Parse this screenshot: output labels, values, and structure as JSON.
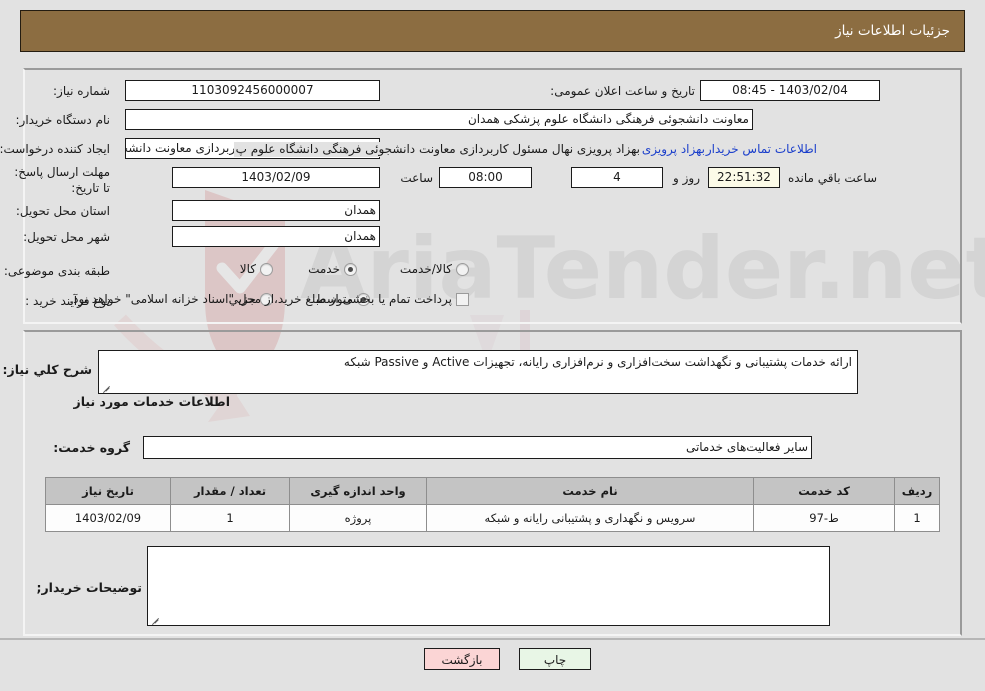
{
  "header": {
    "title": "جزئیات اطلاعات نیاز"
  },
  "top_form": {
    "need_number_label": "شماره نیاز:",
    "need_number_value": "1103092456000007",
    "announce_datetime_label": "تاریخ و ساعت اعلان عمومی:",
    "announce_datetime_value": "1403/02/04 - 08:45",
    "buyer_org_label": "نام دستگاه خریدار:",
    "buyer_org_value": "معاونت دانشجوئی فرهنگی دانشگاه علوم پزشکی همدان",
    "creator_label": "ایجاد کننده درخواست:",
    "creator_value": "بهزاد پرویزی نهال مسئول کاربردازی معاونت دانشجوئی فرهنگی دانشگاه علوم پز",
    "buyer_contact_link": "اطلاعات تماس خریدار",
    "deadline_label": "مهلت ارسال پاسخ: تا تاریخ:",
    "deadline_date": "1403/02/09",
    "deadline_time_label": "ساعت",
    "deadline_time": "08:00",
    "days_remaining": "4",
    "days_label": "روز و",
    "timer_value": "22:51:32",
    "timer_label": "ساعت باقي مانده",
    "province_label": "استان محل تحویل:",
    "province_value": "همدان",
    "city_label": "شهر محل تحویل:",
    "city_value": "همدان",
    "category_label": "طبقه بندی موضوعی:",
    "category_options": [
      {
        "label": "کالا",
        "selected": false
      },
      {
        "label": "خدمت",
        "selected": true
      },
      {
        "label": "کالا/خدمت",
        "selected": false
      }
    ],
    "process_label": "نوع فرآیند خرید :",
    "process_options": [
      {
        "label": "جزیي",
        "selected": false
      },
      {
        "label": "متوسط",
        "selected": true
      }
    ],
    "treasury_checkbox_label": "پرداخت تمام یا بخشی از مبلغ خرید،از محل \"اسناد خزانه اسلامی\" خواهد بود.",
    "treasury_checked": false
  },
  "description": {
    "label": "شرح کلي نیاز:",
    "value": "ارائه خدمات پشتیبانی و نگهداشت سخت‌افزاری و نرم‌افزاری رایانه، تجهیزات Active و Passive شبکه"
  },
  "services_section": {
    "heading": "اطلاعات خدمات مورد نیاز",
    "service_group_label": "گروه خدمت:",
    "service_group_value": "سایر فعالیت‌های خدماتی"
  },
  "items_table": {
    "columns": [
      "ردیف",
      "کد خدمت",
      "نام خدمت",
      "واحد اندازه گیری",
      "تعداد / مقدار",
      "تاریخ نیاز"
    ],
    "rows": [
      {
        "row_no": "1",
        "service_code": "ط-97",
        "service_name": "سرویس و نگهداری و پشتیبانی رایانه و شبکه",
        "unit": "پروژه",
        "quantity": "1",
        "need_date": "1403/02/09"
      }
    ]
  },
  "buyer_notes": {
    "label": "توضیحات خریدار;",
    "value": ""
  },
  "footer": {
    "print_label": "چاپ",
    "back_label": "بازگشت"
  },
  "watermark": {
    "text": "AriaTender.net"
  },
  "colors": {
    "header_bar": "#8c6d41",
    "page_bg": "#e2e2e2",
    "link": "#1a3ecb",
    "table_header": "#c4c4c4",
    "print_btn": "#e8f6e6",
    "back_btn": "#fbd5d5",
    "timer_bg": "#fcfbe8"
  }
}
